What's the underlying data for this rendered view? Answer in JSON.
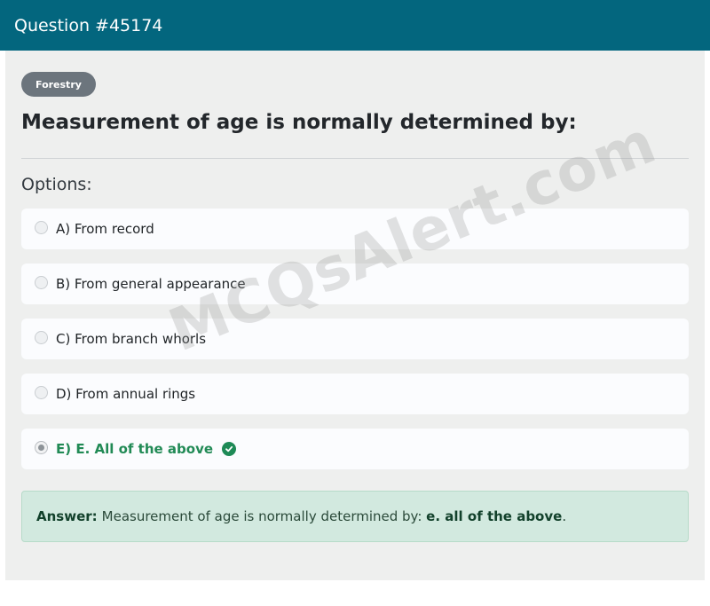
{
  "header": {
    "title": "Question #45174"
  },
  "badge": {
    "label": "Forestry"
  },
  "question": {
    "text": "Measurement of age is normally determined by:"
  },
  "options_label": "Options:",
  "options": [
    {
      "label": "A) From record"
    },
    {
      "label": "B) From general appearance"
    },
    {
      "label": "C) From branch whorls"
    },
    {
      "label": "D) From annual rings"
    },
    {
      "label": "E) E. All of the above"
    }
  ],
  "answer": {
    "label": "Answer:",
    "text": "Measurement of age is normally determined by: ",
    "final": "e. all of the above",
    "period": "."
  },
  "watermark": "MCQsAlert.com",
  "colors": {
    "header_bg": "#03667e",
    "correct": "#218a55",
    "answer_bg": "#d2e9df",
    "badge_bg": "#6c757d"
  },
  "icons": {
    "correct": "check-circle-icon"
  }
}
